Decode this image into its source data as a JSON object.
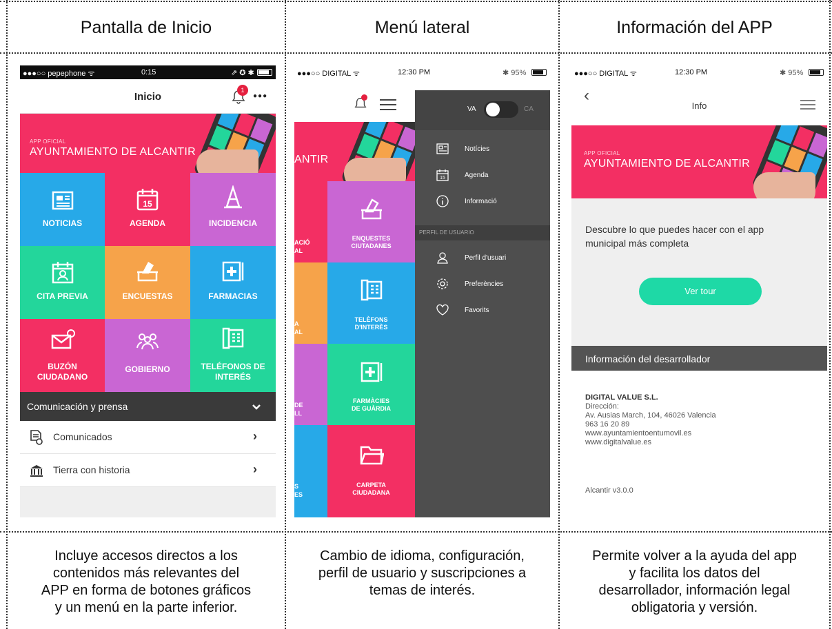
{
  "columns": [
    {
      "title": "Pantalla de Inicio",
      "caption": [
        "Incluye accesos directos a los",
        "contenidos más relevantes del",
        "APP en forma de botones gráficos",
        "y un menú en la parte inferior."
      ]
    },
    {
      "title": "Menú lateral",
      "caption": [
        "Cambio de idioma, configuración,",
        "perfil de usuario y suscripciones a",
        "temas de interés."
      ]
    },
    {
      "title": "Información del APP",
      "caption": [
        "Permite volver a la ayuda del app",
        "y facilita los datos del",
        "desarrollador, información legal",
        "obligatoria y versión."
      ]
    }
  ],
  "screen1": {
    "status": {
      "carrier": "●●●○○ pepephone ᯤ",
      "time": "0:15",
      "icons": "⇗ ✪ ✱"
    },
    "nav_title": "Inicio",
    "notification_count": "1",
    "more": "●●●",
    "hero": {
      "small": "APP OFICIAL",
      "big": "AYUNTAMIENTO DE ALCANTIR"
    },
    "tiles": [
      {
        "label": "NOTICIAS",
        "color": "#27a9e8",
        "icon": "newspaper-icon"
      },
      {
        "label": "AGENDA",
        "color": "#f32f63",
        "icon": "calendar-icon"
      },
      {
        "label": "INCIDENCIA",
        "color": "#c966d3",
        "icon": "cone-icon"
      },
      {
        "label": "CITA PREVIA",
        "color": "#23d69b",
        "icon": "appointment-icon"
      },
      {
        "label": "ENCUESTAS",
        "color": "#f6a34a",
        "icon": "ballot-icon"
      },
      {
        "label": "FARMACIAS",
        "color": "#27a9e8",
        "icon": "pharmacy-icon"
      },
      {
        "label": "BUZÓN",
        "label2": "CIUDADANO",
        "color": "#f32f63",
        "icon": "mail-icon"
      },
      {
        "label": "GOBIERNO",
        "color": "#c966d3",
        "icon": "people-icon"
      },
      {
        "label": "TELÉFONOS DE",
        "label2": "INTERÉS",
        "color": "#23d69b",
        "icon": "phone-directory-icon"
      }
    ],
    "section": "Comunicación y prensa",
    "rows": [
      {
        "label": "Comunicados",
        "icon": "document-icon"
      },
      {
        "label": "Tierra con historia",
        "icon": "monument-icon"
      }
    ]
  },
  "screen2": {
    "status": {
      "carrier": "●●●○○ DIGITAL ᯤ",
      "time": "12:30 PM",
      "battery": "✱ 95%"
    },
    "hero_fragment": "ANTIR",
    "lang_left": "VA",
    "lang_right": "CA",
    "menu": [
      "Notícies",
      "Agenda",
      "Informació"
    ],
    "profile_header": "PERFIL DE USUARIO",
    "profile_menu": [
      "Perfil d'usuari",
      "Preferències",
      "Favorits"
    ],
    "tiles": [
      {
        "label": "ENQUESTES",
        "label2": "CIUTADANES",
        "color": "#c966d3"
      },
      {
        "label": "TELÈFONS",
        "label2": "D'INTERÈS",
        "color": "#27a9e8"
      },
      {
        "label": "FARMÀCIES",
        "label2": "DE GUÀRDIA",
        "color": "#23d69b"
      },
      {
        "label": "CARPETA",
        "label2": "CIUDADANA",
        "color": "#f32f63"
      }
    ],
    "left_fragments": [
      "ACIÓ",
      "AL",
      "A",
      "AL",
      "DE",
      "LL",
      "S",
      "ES"
    ]
  },
  "screen3": {
    "status": {
      "carrier": "●●●○○ DIGITAL ᯤ",
      "time": "12:30 PM",
      "battery": "✱ 95%"
    },
    "back": "‹",
    "nav_title": "Info",
    "hero": {
      "small": "APP OFICIAL",
      "big": "AYUNTAMIENTO DE ALCANTIR"
    },
    "intro": [
      "Descubre lo que puedes hacer con el app",
      "municipal más completa"
    ],
    "tour_button": "Ver tour",
    "dev_header": "Información del desarrollador",
    "dev": {
      "company": "DIGITAL VALUE S.L.",
      "lines": [
        "Dirección:",
        "Av. Ausias March, 104, 46026 Valencia",
        "963 16 20 89",
        "www.ayuntamientoentumovil.es",
        "www.digitalvalue.es"
      ]
    },
    "version": "Alcantir v3.0.0"
  }
}
